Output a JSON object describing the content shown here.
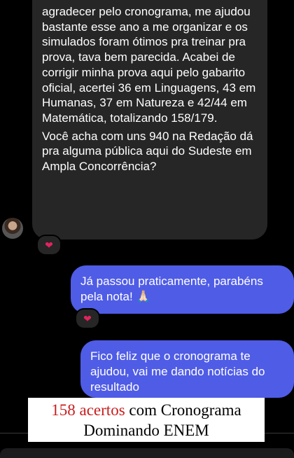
{
  "incoming_message": {
    "paragraph1": "agradecer pelo cronograma, me ajudou bastante esse ano a me organizar e os simulados foram ótimos pra treinar pra prova, tava bem parecida. Acabei de corrigir minha prova aqui pelo gabarito oficial, acertei 36 em Linguagens, 43 em Humanas, 37 em Natureza e 42/44 em Matemática, totalizando 158/179.",
    "paragraph2": "Você acha com uns 940 na Redação dá pra alguma pública aqui do Sudeste em Ampla Concorrência?",
    "reaction": "❤"
  },
  "outgoing_messages": [
    {
      "text": "Já passou praticamente, parabéns pela nota! 🙏🏻",
      "reaction": "❤"
    },
    {
      "text": "Fico feliz que o cronograma te ajudou, vai me dando notícias do resultado"
    }
  ],
  "banner": {
    "highlight": "158 acertos",
    "line1_rest": " com Cronograma",
    "line2": "Dominando ENEM"
  },
  "colors": {
    "incoming_bubble": "#262626",
    "outgoing_bubble": "#4f5ce6",
    "accent_text": "#c81e1e",
    "background": "#000000"
  }
}
